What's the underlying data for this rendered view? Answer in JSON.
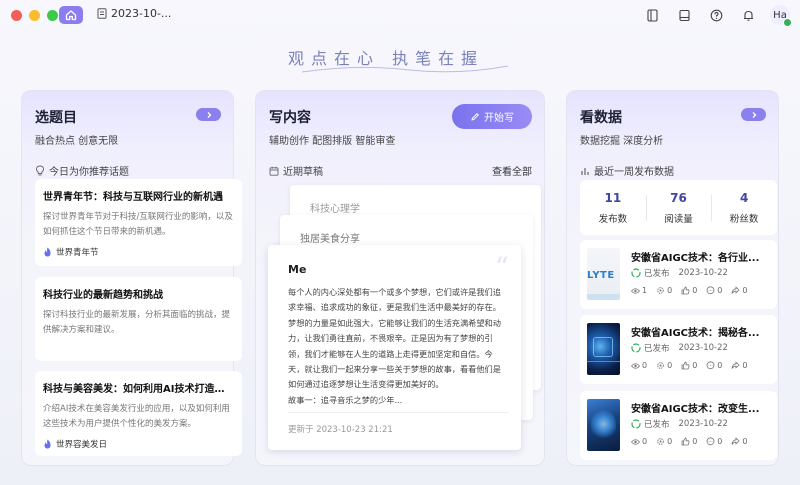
{
  "titlebar": {
    "tab_title": "2023-10-...",
    "avatar_text": "Ha",
    "traffic": {
      "close": "#f25f58",
      "minimize": "#f9be2f",
      "zoom": "#3ec94a"
    },
    "accent": "#8b7cf0"
  },
  "slogan": "观点在心 执笔在握",
  "topics_card": {
    "title": "选题目",
    "subtitle": "融合热点 创意无限",
    "section": "今日为你推荐话题",
    "items": [
      {
        "title": "世界青年节：科技与互联网行业的新机遇",
        "desc": "探讨世界青年节对于科技/互联网行业的影响，以及如何抓住这个节日带来的新机遇。",
        "tag": "世界青年节"
      },
      {
        "title": "科技行业的最新趋势和挑战",
        "desc": "探讨科技行业的最新发展，分析其面临的挑战，提供解决方案和建议。",
        "tag": ""
      },
      {
        "title": "科技与美容美发：如何利用AI技术打造个性化美发方案",
        "desc": "介绍AI技术在美容美发行业的应用，以及如何利用这些技术为用户提供个性化的美发方案。",
        "tag": "世界容美发日"
      }
    ]
  },
  "write_card": {
    "title": "写内容",
    "subtitle": "辅助创作 配图排版 智能审查",
    "start_button": "开始写",
    "drafts_label": "近期草稿",
    "view_all": "查看全部",
    "drafts": [
      "科技心理学",
      "独居美食分享"
    ],
    "note": {
      "title": "Me",
      "body": "每个人的内心深处都有一个或多个梦想，它们或许是我们追求幸福、追求成功的象征，更是我们生活中最美好的存在。梦想的力量是如此强大，它能够让我们的生活充满希望和动力，让我们勇往直前，不畏艰辛。正是因为有了梦想的引领，我们才能够在人生的道路上走得更加坚定和自信。今天，就让我们一起来分享一些关于梦想的故事，看看他们是如何通过追逐梦想让生活变得更加美好的。",
      "story": "故事一：追寻音乐之梦的少年...",
      "updated": "更新于 2023-10-23 21:21"
    }
  },
  "data_card": {
    "title": "看数据",
    "subtitle": "数据挖掘 深度分析",
    "section": "最近一周发布数据",
    "stats": [
      {
        "value": "11",
        "label": "发布数"
      },
      {
        "value": "76",
        "label": "阅读量"
      },
      {
        "value": "4",
        "label": "粉丝数"
      }
    ],
    "articles": [
      {
        "title": "安徽省AIGC技术：各行业...",
        "status": "已发布",
        "date": "2023-10-22",
        "views": "1",
        "a": "0",
        "likes": "0",
        "comments": "0",
        "shares": "0",
        "thumb": "LYTE"
      },
      {
        "title": "安徽省AIGC技术：揭秘各...",
        "status": "已发布",
        "date": "2023-10-22",
        "views": "0",
        "a": "0",
        "likes": "0",
        "comments": "0",
        "shares": "0",
        "thumb": ""
      },
      {
        "title": "安徽省AIGC技术：改变生...",
        "status": "已发布",
        "date": "2023-10-22",
        "views": "0",
        "a": "0",
        "likes": "0",
        "comments": "0",
        "shares": "0",
        "thumb": ""
      }
    ]
  }
}
